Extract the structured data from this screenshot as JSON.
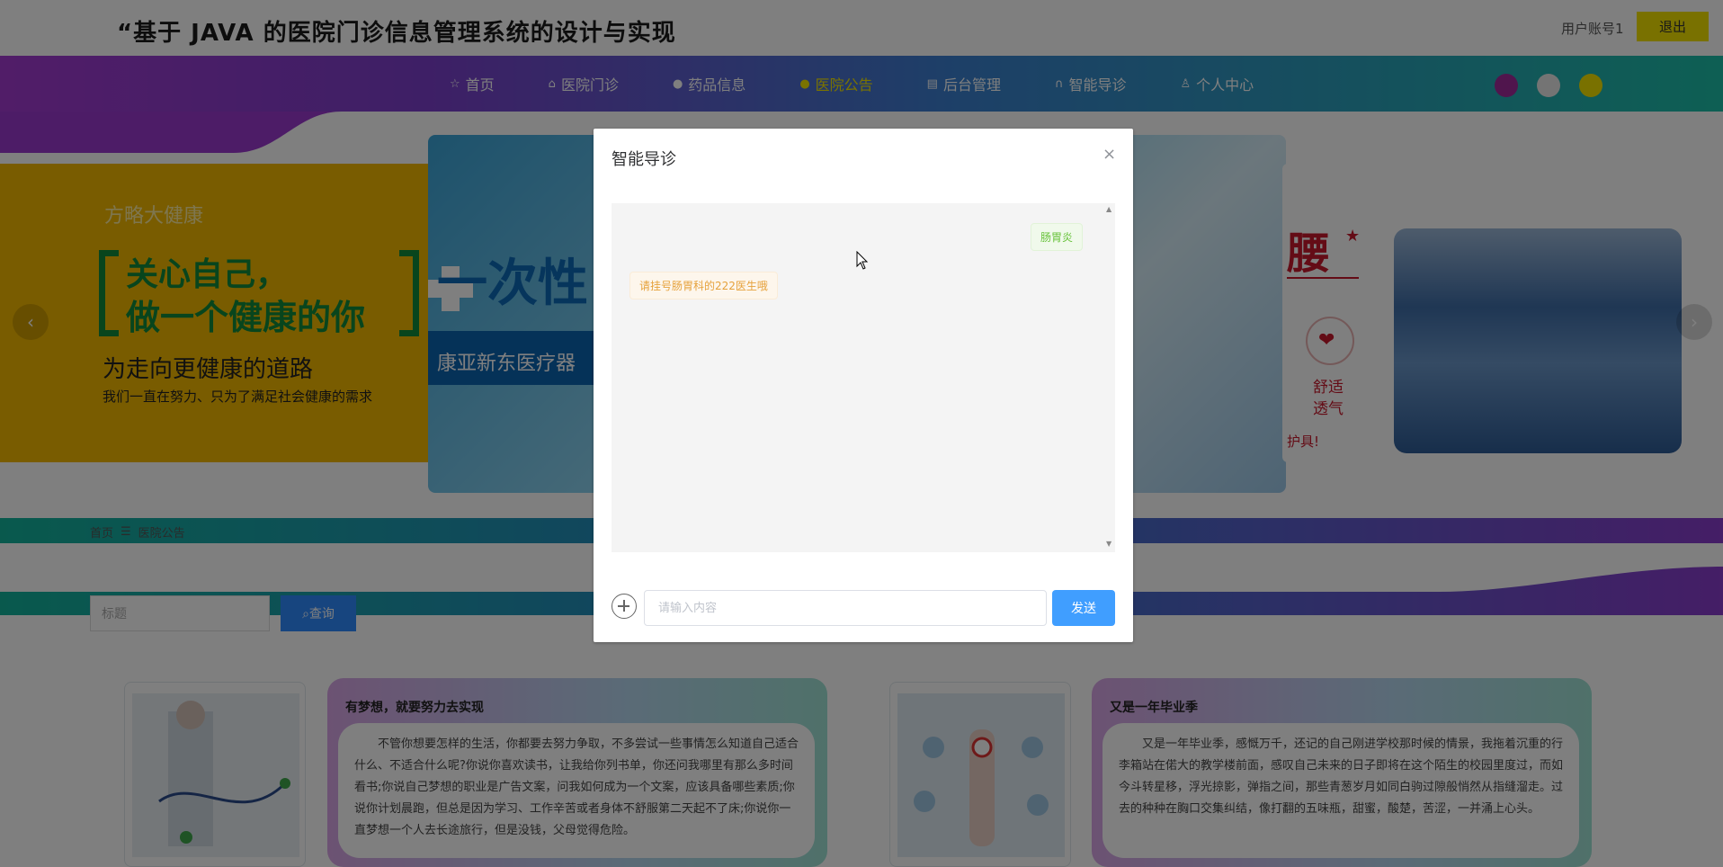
{
  "header": {
    "title": "“基于 JAVA 的医院门诊信息管理系统的设计与实现",
    "user_label": "用户账号1",
    "logout_label": "退出"
  },
  "nav": {
    "items": [
      {
        "icon": "star-icon",
        "label": "首页"
      },
      {
        "icon": "building-icon",
        "label": "医院门诊"
      },
      {
        "icon": "circle-icon",
        "label": "药品信息"
      },
      {
        "icon": "dot-icon",
        "label": "医院公告"
      },
      {
        "icon": "store-icon",
        "label": "后台管理"
      },
      {
        "icon": "headset-icon",
        "label": "智能导诊"
      },
      {
        "icon": "user-icon",
        "label": "个人中心"
      }
    ],
    "active_index": 3,
    "theme_colors": [
      "#a02a9a",
      "#e8e8e8",
      "#f2e200"
    ]
  },
  "banner": {
    "slide1": {
      "brand": "方略大健康",
      "headline1": "关心自己，",
      "headline2": "做一个健康的你",
      "heading": "为走向更健康的道路",
      "text": "我们一直在努力、只为了满足社会健康的需求"
    },
    "slide2": {
      "headline": "一次性",
      "company": "康亚新东医疗器"
    },
    "slide3": {
      "headline": "腰",
      "feature1": "舒适",
      "feature2": "透气",
      "footer": "护具!"
    },
    "prev_arrow": "‹",
    "next_arrow": "›"
  },
  "breadcrumb": {
    "home": "首页",
    "separator": "☰",
    "current": "医院公告"
  },
  "search": {
    "placeholder": "标题",
    "button_label": "查询"
  },
  "cards": [
    {
      "title": "有梦想，就要努力去实现",
      "body": "不管你想要怎样的生活，你都要去努力争取，不多尝试一些事情怎么知道自己适合什么、不适合什么呢?你说你喜欢读书，让我给你列书单，你还问我哪里有那么多时间看书;你说自己梦想的职业是广告文案，问我如何成为一个文案，应该具备哪些素质;你说你计划晨跑，但总是因为学习、工作辛苦或者身体不舒服第二天起不了床;你说你一直梦想一个人去长途旅行，但是没钱，父母觉得危险。"
    },
    {
      "title": "又是一年毕业季",
      "body": "又是一年毕业季，感慨万千，还记的自己刚进学校那时候的情景，我拖着沉重的行李箱站在偌大的教学楼前面，感叹自己未来的日子即将在这个陌生的校园里度过，而如今斗转星移，浮光掠影，弹指之间，那些青葱岁月如同白驹过隙般悄然从指缝溜走。过去的种种在胸口交集纠结，像打翻的五味瓶，甜蜜，酸楚，苦涩，一并涌上心头。"
    }
  ],
  "modal": {
    "title": "智能导诊",
    "close_symbol": "×",
    "messages": [
      {
        "from": "user",
        "text": "肠胃炎"
      },
      {
        "from": "bot",
        "text": "请挂号肠胃科的222医生哦"
      }
    ],
    "input_placeholder": "请输入内容",
    "input_value": "",
    "send_label": "发送"
  }
}
